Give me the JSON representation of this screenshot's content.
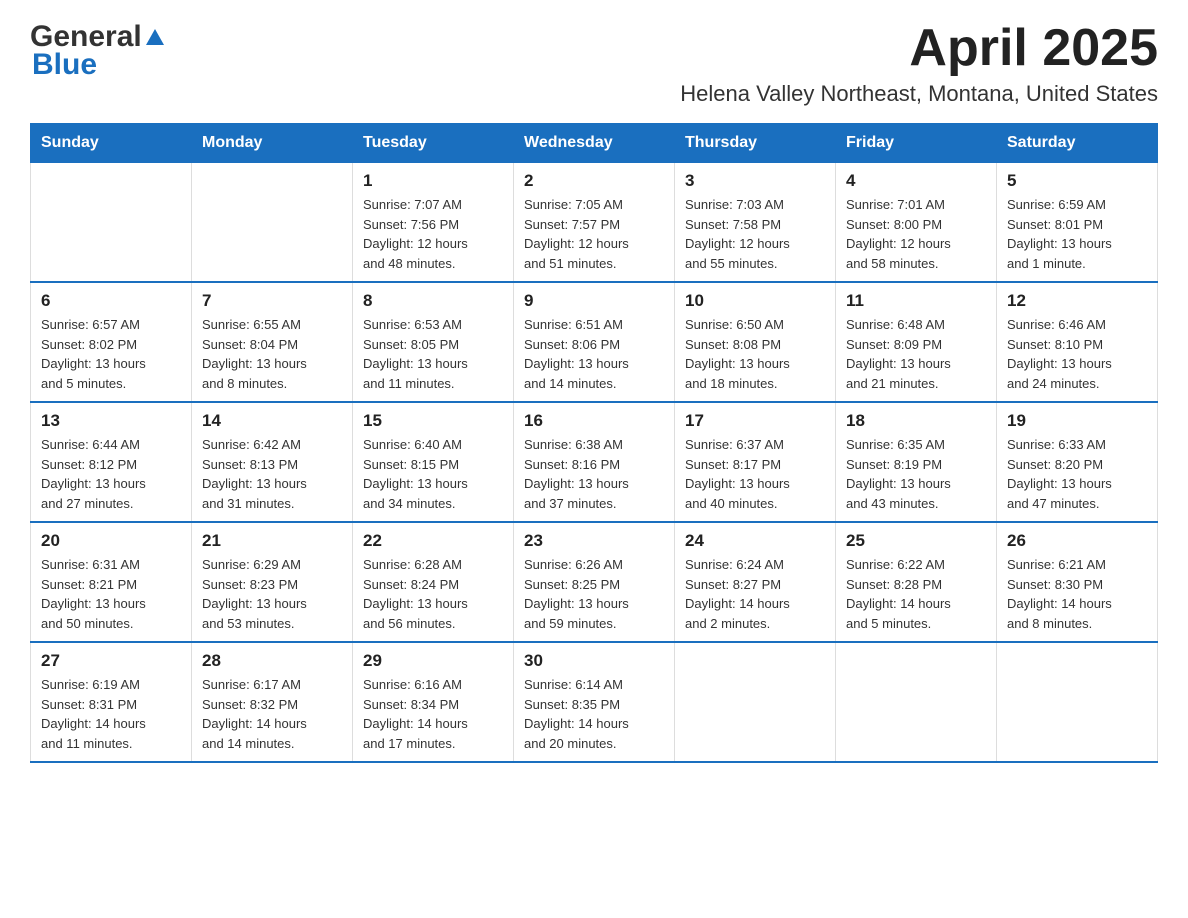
{
  "logo": {
    "text1": "General",
    "text2": "Blue"
  },
  "title": {
    "month": "April 2025",
    "location": "Helena Valley Northeast, Montana, United States"
  },
  "headers": [
    "Sunday",
    "Monday",
    "Tuesday",
    "Wednesday",
    "Thursday",
    "Friday",
    "Saturday"
  ],
  "weeks": [
    [
      {
        "day": "",
        "info": ""
      },
      {
        "day": "",
        "info": ""
      },
      {
        "day": "1",
        "info": "Sunrise: 7:07 AM\nSunset: 7:56 PM\nDaylight: 12 hours\nand 48 minutes."
      },
      {
        "day": "2",
        "info": "Sunrise: 7:05 AM\nSunset: 7:57 PM\nDaylight: 12 hours\nand 51 minutes."
      },
      {
        "day": "3",
        "info": "Sunrise: 7:03 AM\nSunset: 7:58 PM\nDaylight: 12 hours\nand 55 minutes."
      },
      {
        "day": "4",
        "info": "Sunrise: 7:01 AM\nSunset: 8:00 PM\nDaylight: 12 hours\nand 58 minutes."
      },
      {
        "day": "5",
        "info": "Sunrise: 6:59 AM\nSunset: 8:01 PM\nDaylight: 13 hours\nand 1 minute."
      }
    ],
    [
      {
        "day": "6",
        "info": "Sunrise: 6:57 AM\nSunset: 8:02 PM\nDaylight: 13 hours\nand 5 minutes."
      },
      {
        "day": "7",
        "info": "Sunrise: 6:55 AM\nSunset: 8:04 PM\nDaylight: 13 hours\nand 8 minutes."
      },
      {
        "day": "8",
        "info": "Sunrise: 6:53 AM\nSunset: 8:05 PM\nDaylight: 13 hours\nand 11 minutes."
      },
      {
        "day": "9",
        "info": "Sunrise: 6:51 AM\nSunset: 8:06 PM\nDaylight: 13 hours\nand 14 minutes."
      },
      {
        "day": "10",
        "info": "Sunrise: 6:50 AM\nSunset: 8:08 PM\nDaylight: 13 hours\nand 18 minutes."
      },
      {
        "day": "11",
        "info": "Sunrise: 6:48 AM\nSunset: 8:09 PM\nDaylight: 13 hours\nand 21 minutes."
      },
      {
        "day": "12",
        "info": "Sunrise: 6:46 AM\nSunset: 8:10 PM\nDaylight: 13 hours\nand 24 minutes."
      }
    ],
    [
      {
        "day": "13",
        "info": "Sunrise: 6:44 AM\nSunset: 8:12 PM\nDaylight: 13 hours\nand 27 minutes."
      },
      {
        "day": "14",
        "info": "Sunrise: 6:42 AM\nSunset: 8:13 PM\nDaylight: 13 hours\nand 31 minutes."
      },
      {
        "day": "15",
        "info": "Sunrise: 6:40 AM\nSunset: 8:15 PM\nDaylight: 13 hours\nand 34 minutes."
      },
      {
        "day": "16",
        "info": "Sunrise: 6:38 AM\nSunset: 8:16 PM\nDaylight: 13 hours\nand 37 minutes."
      },
      {
        "day": "17",
        "info": "Sunrise: 6:37 AM\nSunset: 8:17 PM\nDaylight: 13 hours\nand 40 minutes."
      },
      {
        "day": "18",
        "info": "Sunrise: 6:35 AM\nSunset: 8:19 PM\nDaylight: 13 hours\nand 43 minutes."
      },
      {
        "day": "19",
        "info": "Sunrise: 6:33 AM\nSunset: 8:20 PM\nDaylight: 13 hours\nand 47 minutes."
      }
    ],
    [
      {
        "day": "20",
        "info": "Sunrise: 6:31 AM\nSunset: 8:21 PM\nDaylight: 13 hours\nand 50 minutes."
      },
      {
        "day": "21",
        "info": "Sunrise: 6:29 AM\nSunset: 8:23 PM\nDaylight: 13 hours\nand 53 minutes."
      },
      {
        "day": "22",
        "info": "Sunrise: 6:28 AM\nSunset: 8:24 PM\nDaylight: 13 hours\nand 56 minutes."
      },
      {
        "day": "23",
        "info": "Sunrise: 6:26 AM\nSunset: 8:25 PM\nDaylight: 13 hours\nand 59 minutes."
      },
      {
        "day": "24",
        "info": "Sunrise: 6:24 AM\nSunset: 8:27 PM\nDaylight: 14 hours\nand 2 minutes."
      },
      {
        "day": "25",
        "info": "Sunrise: 6:22 AM\nSunset: 8:28 PM\nDaylight: 14 hours\nand 5 minutes."
      },
      {
        "day": "26",
        "info": "Sunrise: 6:21 AM\nSunset: 8:30 PM\nDaylight: 14 hours\nand 8 minutes."
      }
    ],
    [
      {
        "day": "27",
        "info": "Sunrise: 6:19 AM\nSunset: 8:31 PM\nDaylight: 14 hours\nand 11 minutes."
      },
      {
        "day": "28",
        "info": "Sunrise: 6:17 AM\nSunset: 8:32 PM\nDaylight: 14 hours\nand 14 minutes."
      },
      {
        "day": "29",
        "info": "Sunrise: 6:16 AM\nSunset: 8:34 PM\nDaylight: 14 hours\nand 17 minutes."
      },
      {
        "day": "30",
        "info": "Sunrise: 6:14 AM\nSunset: 8:35 PM\nDaylight: 14 hours\nand 20 minutes."
      },
      {
        "day": "",
        "info": ""
      },
      {
        "day": "",
        "info": ""
      },
      {
        "day": "",
        "info": ""
      }
    ]
  ]
}
